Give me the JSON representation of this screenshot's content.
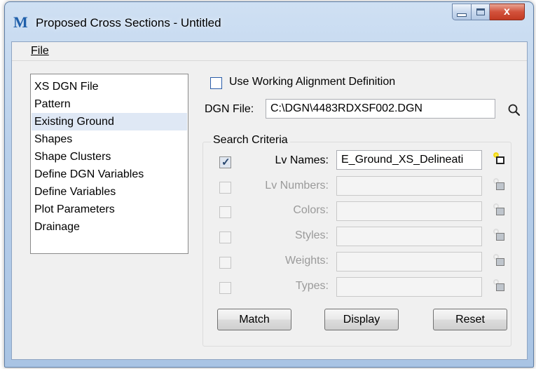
{
  "window": {
    "title": "Proposed Cross Sections - Untitled",
    "app_icon_glyph": "Μ",
    "close_glyph": "x"
  },
  "menu": {
    "file_label": "File"
  },
  "nav": {
    "items": [
      "XS DGN File",
      "Pattern",
      "Existing Ground",
      "Shapes",
      "Shape Clusters",
      "Define DGN Variables",
      "Define Variables",
      "Plot Parameters",
      "Drainage"
    ],
    "selected": "Existing Ground"
  },
  "options": {
    "working_alignment_label": "Use Working Alignment Definition",
    "working_alignment_checked": false
  },
  "dgn_file": {
    "label": "DGN File:",
    "value": "C:\\DGN\\4483RDXSF002.DGN"
  },
  "search_criteria": {
    "title": "Search Criteria",
    "rows": [
      {
        "label": "Lv Names:",
        "value": "E_Ground_XS_Delineati",
        "checked": true,
        "enabled": true
      },
      {
        "label": "Lv Numbers:",
        "value": "",
        "checked": false,
        "enabled": false
      },
      {
        "label": "Colors:",
        "value": "",
        "checked": false,
        "enabled": false
      },
      {
        "label": "Styles:",
        "value": "",
        "checked": false,
        "enabled": false
      },
      {
        "label": "Weights:",
        "value": "",
        "checked": false,
        "enabled": false
      },
      {
        "label": "Types:",
        "value": "",
        "checked": false,
        "enabled": false
      }
    ]
  },
  "buttons": {
    "match": "Match",
    "display": "Display",
    "reset": "Reset"
  },
  "colors": {
    "selection_bg": "#dfe8f5",
    "close_button": "#c23a23",
    "accent_blue": "#2a5ca8"
  }
}
